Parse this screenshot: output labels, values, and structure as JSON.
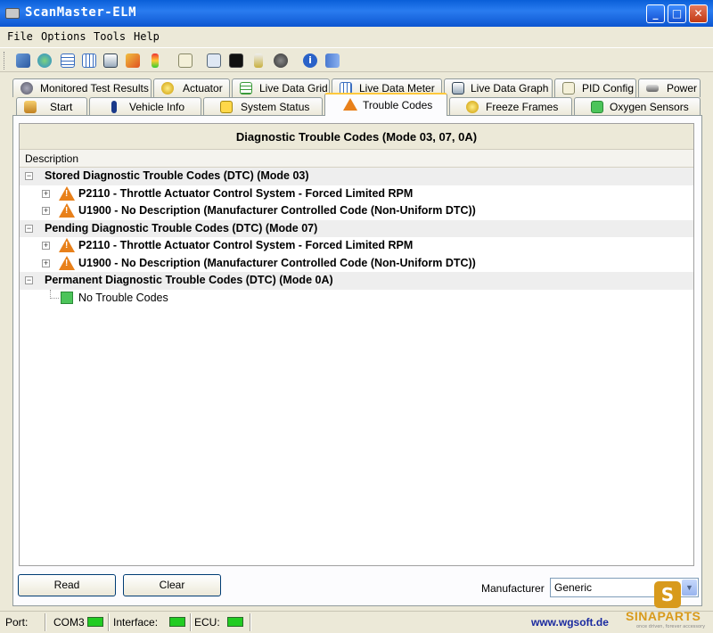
{
  "window": {
    "title": "ScanMaster-ELM",
    "minimize": "_",
    "maximize": "□",
    "close": "✕"
  },
  "menu": [
    "File",
    "Options",
    "Tools",
    "Help"
  ],
  "toolbar_icons": [
    "wrench-icon",
    "globe-icon",
    "table-icon",
    "grid-icon",
    "gauge-icon",
    "chart-icon",
    "traffic-light-icon",
    "clipboard-icon",
    "search-icon",
    "terminal-icon",
    "battery-icon",
    "disc-icon",
    "info-icon",
    "book-icon"
  ],
  "tabs_row1": [
    "Monitored Test Results",
    "Actuator",
    "Live Data Grid",
    "Live Data Meter",
    "Live Data Graph",
    "PID Config",
    "Power"
  ],
  "tabs_row2": [
    "Start",
    "Vehicle Info",
    "System Status",
    "Trouble Codes",
    "Freeze Frames",
    "Oxygen Sensors"
  ],
  "active_tab": "Trouble Codes",
  "panel": {
    "header": "Diagnostic Trouble Codes (Mode 03, 07, 0A)",
    "column": "Description",
    "groups": [
      {
        "title": "Stored Diagnostic Trouble Codes (DTC) (Mode 03)",
        "items": [
          "P2110 - Throttle Actuator Control System - Forced Limited RPM",
          "U1900 - No Description (Manufacturer Controlled Code (Non-Uniform DTC))"
        ]
      },
      {
        "title": "Pending Diagnostic Trouble Codes (DTC) (Mode 07)",
        "items": [
          "P2110 - Throttle Actuator Control System - Forced Limited RPM",
          "U1900 - No Description (Manufacturer Controlled Code (Non-Uniform DTC))"
        ]
      },
      {
        "title": "Permanent Diagnostic Trouble Codes (DTC) (Mode 0A)",
        "no_codes": "No Trouble Codes"
      }
    ]
  },
  "buttons": {
    "read": "Read",
    "clear": "Clear"
  },
  "manufacturer": {
    "label": "Manufacturer",
    "value": "Generic"
  },
  "status": {
    "port_label": "Port:",
    "port_value": "COM3",
    "interface_label": "Interface:",
    "ecu_label": "ECU:",
    "website": "www.wgsoft.de",
    "led_color": "#22cc22"
  },
  "watermark": {
    "badge": "S",
    "brand": "SINAPARTS",
    "tagline": "once driven, forever accessory"
  }
}
